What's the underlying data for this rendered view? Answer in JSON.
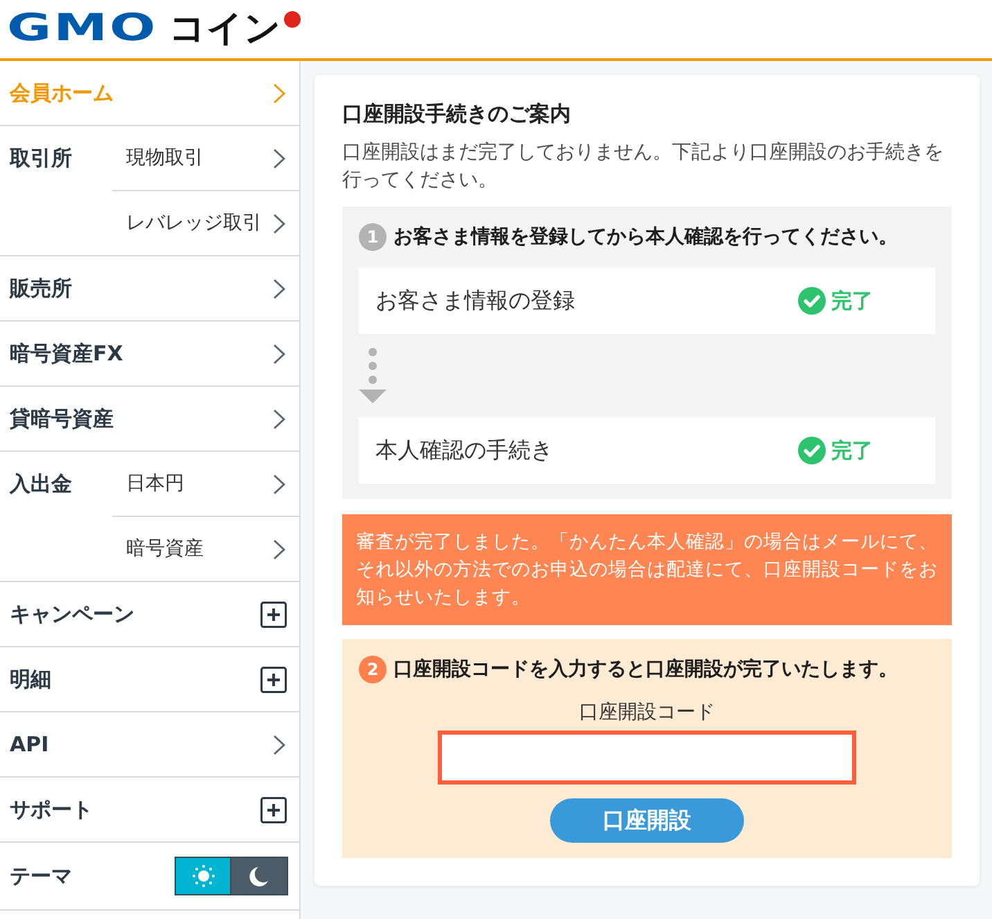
{
  "header": {
    "logo": {
      "latin": "GMO",
      "katakana": "コイン"
    }
  },
  "sidebar": {
    "items": [
      {
        "kind": "link",
        "label": "会員ホーム",
        "selected": true
      },
      {
        "kind": "group",
        "label": "取引所",
        "children": [
          {
            "label": "現物取引",
            "selected": false
          },
          {
            "label": "レバレッジ取引",
            "selected": false
          }
        ]
      },
      {
        "kind": "link",
        "label": "販売所",
        "selected": false
      },
      {
        "kind": "link",
        "label": "暗号資産FX",
        "selected": false
      },
      {
        "kind": "link",
        "label": "貸暗号資産",
        "selected": false
      },
      {
        "kind": "group",
        "label": "入出金",
        "children": [
          {
            "label": "日本円",
            "selected": false
          },
          {
            "label": "暗号資産",
            "selected": false
          }
        ]
      },
      {
        "kind": "expandable",
        "label": "キャンペーン",
        "expanded": false
      },
      {
        "kind": "expandable",
        "label": "明細",
        "expanded": false
      },
      {
        "kind": "link",
        "label": "API",
        "selected": false
      },
      {
        "kind": "expandable",
        "label": "サポート",
        "expanded": false
      },
      {
        "kind": "theme",
        "label": "テーマ",
        "options": [
          {
            "kind": "light",
            "selected": true
          },
          {
            "kind": "dark",
            "selected": false
          }
        ]
      }
    ]
  },
  "main": {
    "title": "口座開設手続きのご案内",
    "intro": "口座開設はまだ完了しておりません。下記より口座開設のお手続きを行ってください。",
    "sections": [
      {
        "kind": "tasks",
        "number": "1",
        "active": false,
        "heading": "お客さま情報を登録してから本人確認を行ってください。",
        "tasks": [
          {
            "label": "お客さま情報の登録",
            "done": true,
            "status": "完了"
          },
          {
            "label": "本人確認の手続き",
            "done": true,
            "status": "完了"
          }
        ]
      },
      {
        "kind": "notice",
        "text": "審査が完了しました。「かんたん本人確認」の場合はメールにて、それ以外の方法でのお申込の場合は配達にて、口座開設コードをお知らせいたします。"
      },
      {
        "kind": "code_entry",
        "number": "2",
        "active": true,
        "heading": "口座開設コードを入力すると口座開設が完了いたします。",
        "field_label": "口座開設コード",
        "button": "口座開設"
      }
    ]
  }
}
